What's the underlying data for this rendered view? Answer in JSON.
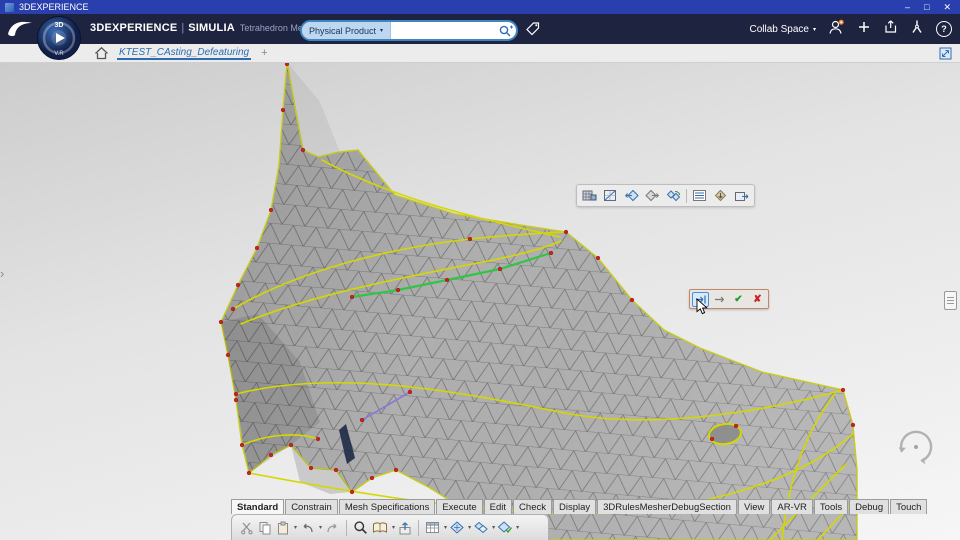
{
  "window": {
    "title": "3DEXPERIENCE",
    "controls": {
      "minimize": "–",
      "maximize": "□",
      "close": "✕"
    }
  },
  "topbar": {
    "brand": "3DEXPERIENCE",
    "divider": "|",
    "app": "SIMULIA",
    "module": "Tetrahedron Mesher",
    "search": {
      "scope": "Physical Product",
      "value": ""
    },
    "collab_label": "Collab Space",
    "help": "?"
  },
  "compass": {
    "top": "3D",
    "bottom": "V.R"
  },
  "tabbar": {
    "active_tab": "KTEST_CAsting_Defeaturing",
    "add": "+"
  },
  "action_tabs": [
    "Standard",
    "Constrain",
    "Mesh Specifications",
    "Execute",
    "Edit",
    "Check",
    "Display",
    "3DRulesMesherDebugSection",
    "View",
    "AR-VR",
    "Tools",
    "Debug",
    "Touch"
  ],
  "dialog": {
    "ok": "✔",
    "cancel": "✘"
  },
  "ui": {
    "caret": "▾",
    "flyout": "›"
  },
  "mesh_colors": {
    "fill": "#b2b2b2",
    "wire": "#6e6e6e",
    "feature_edge": "#d4d800",
    "highlight_edge": "#30c545",
    "vertex": "#cf1f1f",
    "selected_edge": "#8877dd"
  }
}
